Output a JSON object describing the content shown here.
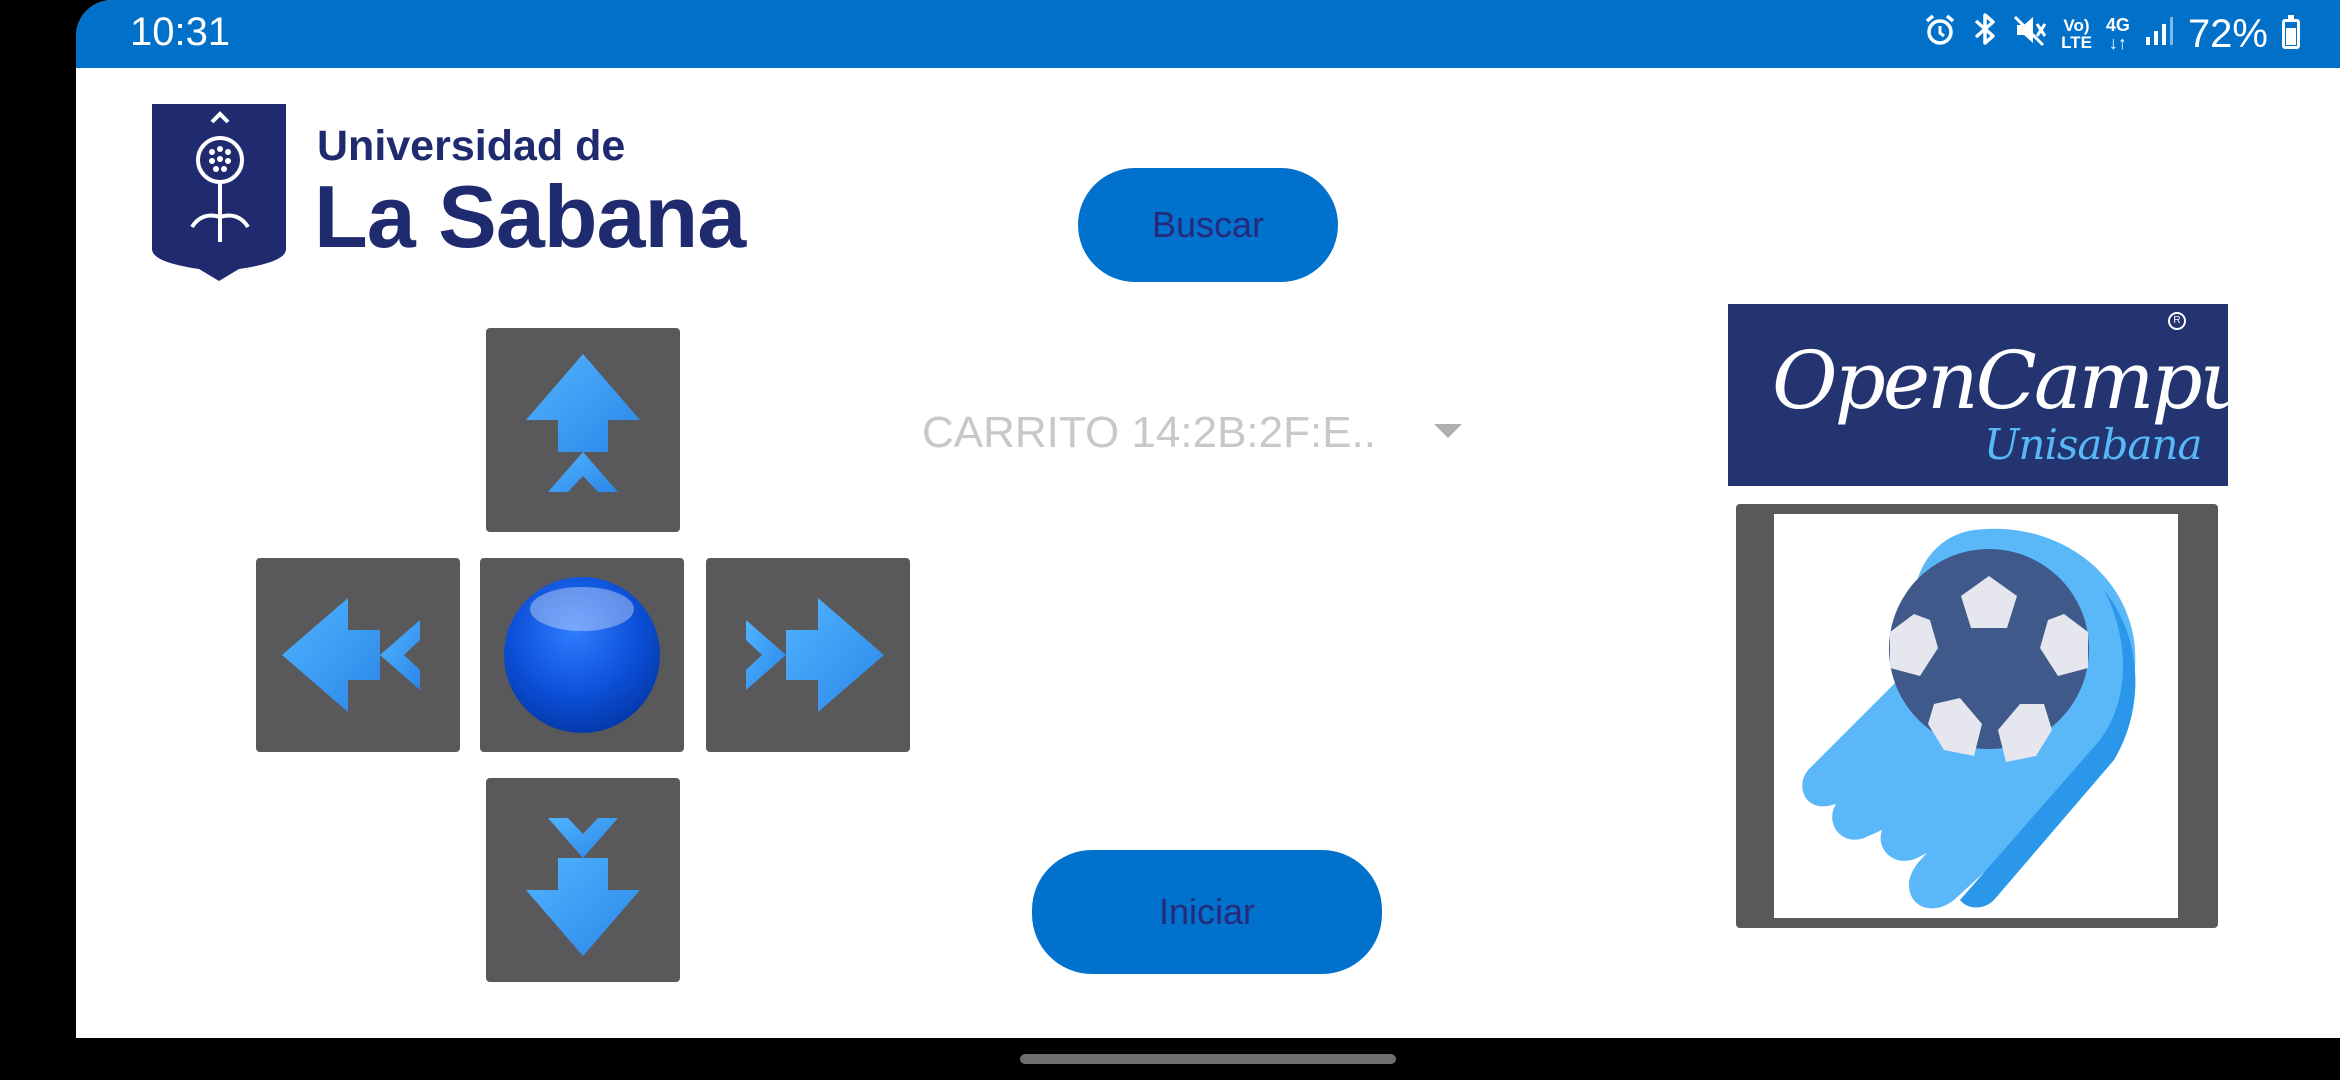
{
  "status_bar": {
    "time": "10:31",
    "volte": "Vo)\nLTE",
    "network": "4G",
    "battery": "72%",
    "icons": [
      "alarm-icon",
      "bluetooth-icon",
      "mute-icon",
      "volte-icon",
      "4g-icon",
      "signal-icon",
      "battery-icon"
    ]
  },
  "logo": {
    "line1": "Universidad de",
    "line2": "La Sabana"
  },
  "buttons": {
    "search_label": "Buscar",
    "start_label": "Iniciar"
  },
  "device_select": {
    "selected": "CARRITO 14:2B:2F:E.."
  },
  "dpad": {
    "icons": [
      "arrow-up-icon",
      "arrow-left-icon",
      "stop-circle-icon",
      "arrow-right-icon",
      "arrow-down-icon"
    ]
  },
  "open_campus": {
    "title": "OpenCampus!",
    "subtitle": "Unisabana"
  },
  "colors": {
    "status_bar": "#0070c9",
    "button": "#0072cd",
    "button_text": "#262a7a",
    "pad": "#59595b",
    "arrow": "#3fa2f5",
    "brand_navy": "#1f2b6e"
  }
}
